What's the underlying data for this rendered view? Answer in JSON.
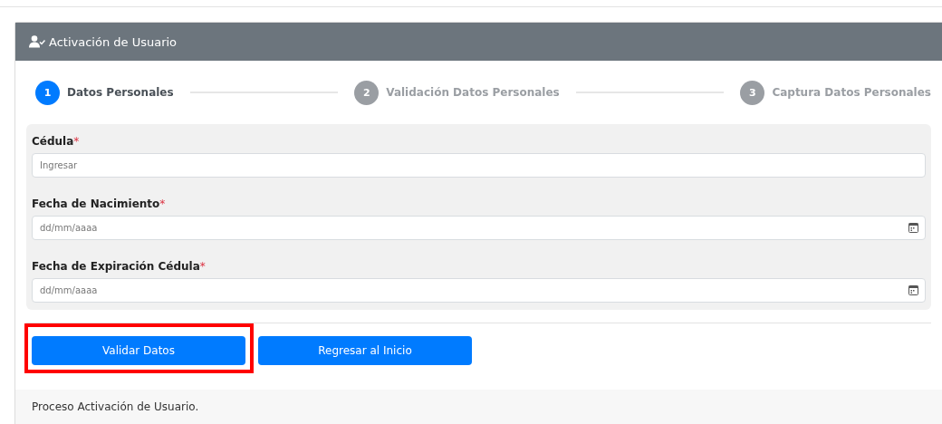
{
  "card": {
    "title": "Activación de Usuario"
  },
  "steps": [
    {
      "number": "1",
      "label": "Datos Personales",
      "selected": true
    },
    {
      "number": "2",
      "label": "Validación Datos Personales",
      "selected": false
    },
    {
      "number": "3",
      "label": "Captura Datos Personales",
      "selected": false
    }
  ],
  "fields": [
    {
      "kind": "text",
      "label": "Cédula",
      "required_mark": "*",
      "placeholder": "Ingresar"
    },
    {
      "kind": "date",
      "label": "Fecha de Nacimiento",
      "required_mark": "*",
      "placeholder": "dd/mm/aaaa"
    },
    {
      "kind": "date",
      "label": "Fecha de Expiración Cédula",
      "required_mark": "*",
      "placeholder": "dd/mm/aaaa"
    }
  ],
  "buttons": [
    {
      "label": "Validar Datos",
      "highlighted": true
    },
    {
      "label": "Regresar al Inicio",
      "highlighted": false
    }
  ],
  "footer": "Proceso Activación de Usuario."
}
